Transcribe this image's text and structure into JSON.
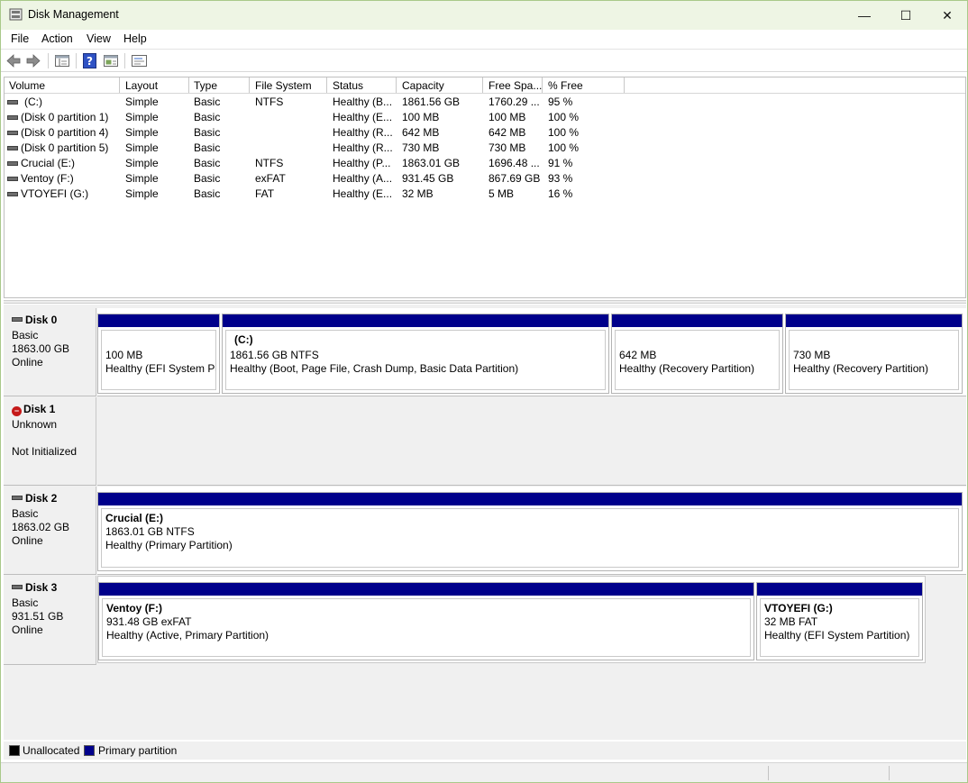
{
  "window": {
    "title": "Disk Management",
    "minimize": "—",
    "maximize": "☐",
    "close": "✕"
  },
  "menu": [
    "File",
    "Action",
    "View",
    "Help"
  ],
  "toolbar": {
    "icons": [
      "back-arrow-icon",
      "forward-arrow-icon",
      "console-tree-icon",
      "help-icon",
      "show-pane-icon",
      "properties-icon"
    ]
  },
  "volumes": {
    "columns": [
      "Volume",
      "Layout",
      "Type",
      "File System",
      "Status",
      "Capacity",
      "Free Spa...",
      "% Free"
    ],
    "rows": [
      [
        "(C:)",
        "Simple",
        "Basic",
        "NTFS",
        "Healthy (B...",
        "1861.56 GB",
        "1760.29 ...",
        "95 %"
      ],
      [
        "(Disk 0 partition 1)",
        "Simple",
        "Basic",
        "",
        "Healthy (E...",
        "100 MB",
        "100 MB",
        "100 %"
      ],
      [
        "(Disk 0 partition 4)",
        "Simple",
        "Basic",
        "",
        "Healthy (R...",
        "642 MB",
        "642 MB",
        "100 %"
      ],
      [
        "(Disk 0 partition 5)",
        "Simple",
        "Basic",
        "",
        "Healthy (R...",
        "730 MB",
        "730 MB",
        "100 %"
      ],
      [
        "Crucial (E:)",
        "Simple",
        "Basic",
        "NTFS",
        "Healthy (P...",
        "1863.01 GB",
        "1696.48 ...",
        "91 %"
      ],
      [
        "Ventoy (F:)",
        "Simple",
        "Basic",
        "exFAT",
        "Healthy (A...",
        "931.45 GB",
        "867.69 GB",
        "93 %"
      ],
      [
        "VTOYEFI (G:)",
        "Simple",
        "Basic",
        "FAT",
        "Healthy (E...",
        "32 MB",
        "5 MB",
        "16 %"
      ]
    ]
  },
  "disks": [
    {
      "name": "Disk 0",
      "type": "Basic",
      "size": "1863.00 GB",
      "state": "Online",
      "partitions": [
        {
          "title": "",
          "line1": "100 MB",
          "line2": "Healthy (EFI System Par"
        },
        {
          "title": "(C:)",
          "line1": "1861.56 GB NTFS",
          "line2": "Healthy (Boot, Page File, Crash Dump, Basic Data Partition)"
        },
        {
          "title": "",
          "line1": "642 MB",
          "line2": "Healthy (Recovery Partition)"
        },
        {
          "title": "",
          "line1": "730 MB",
          "line2": "Healthy (Recovery Partition)"
        }
      ]
    },
    {
      "name": "Disk 1",
      "type": "Unknown",
      "size": "",
      "state": "Not Initialized",
      "partitions": []
    },
    {
      "name": "Disk 2",
      "type": "Basic",
      "size": "1863.02 GB",
      "state": "Online",
      "partitions": [
        {
          "title": "Crucial  (E:)",
          "line1": "1863.01 GB NTFS",
          "line2": "Healthy (Primary Partition)"
        }
      ]
    },
    {
      "name": "Disk 3",
      "type": "Basic",
      "size": "931.51 GB",
      "state": "Online",
      "partitions": [
        {
          "title": "Ventoy  (F:)",
          "line1": "931.48 GB exFAT",
          "line2": "Healthy (Active, Primary Partition)"
        },
        {
          "title": "VTOYEFI  (G:)",
          "line1": "32 MB FAT",
          "line2": "Healthy (EFI System Partition)"
        }
      ]
    }
  ],
  "legend": [
    {
      "label": "Unallocated",
      "color": "#000000"
    },
    {
      "label": "Primary partition",
      "color": "#00008b"
    }
  ]
}
